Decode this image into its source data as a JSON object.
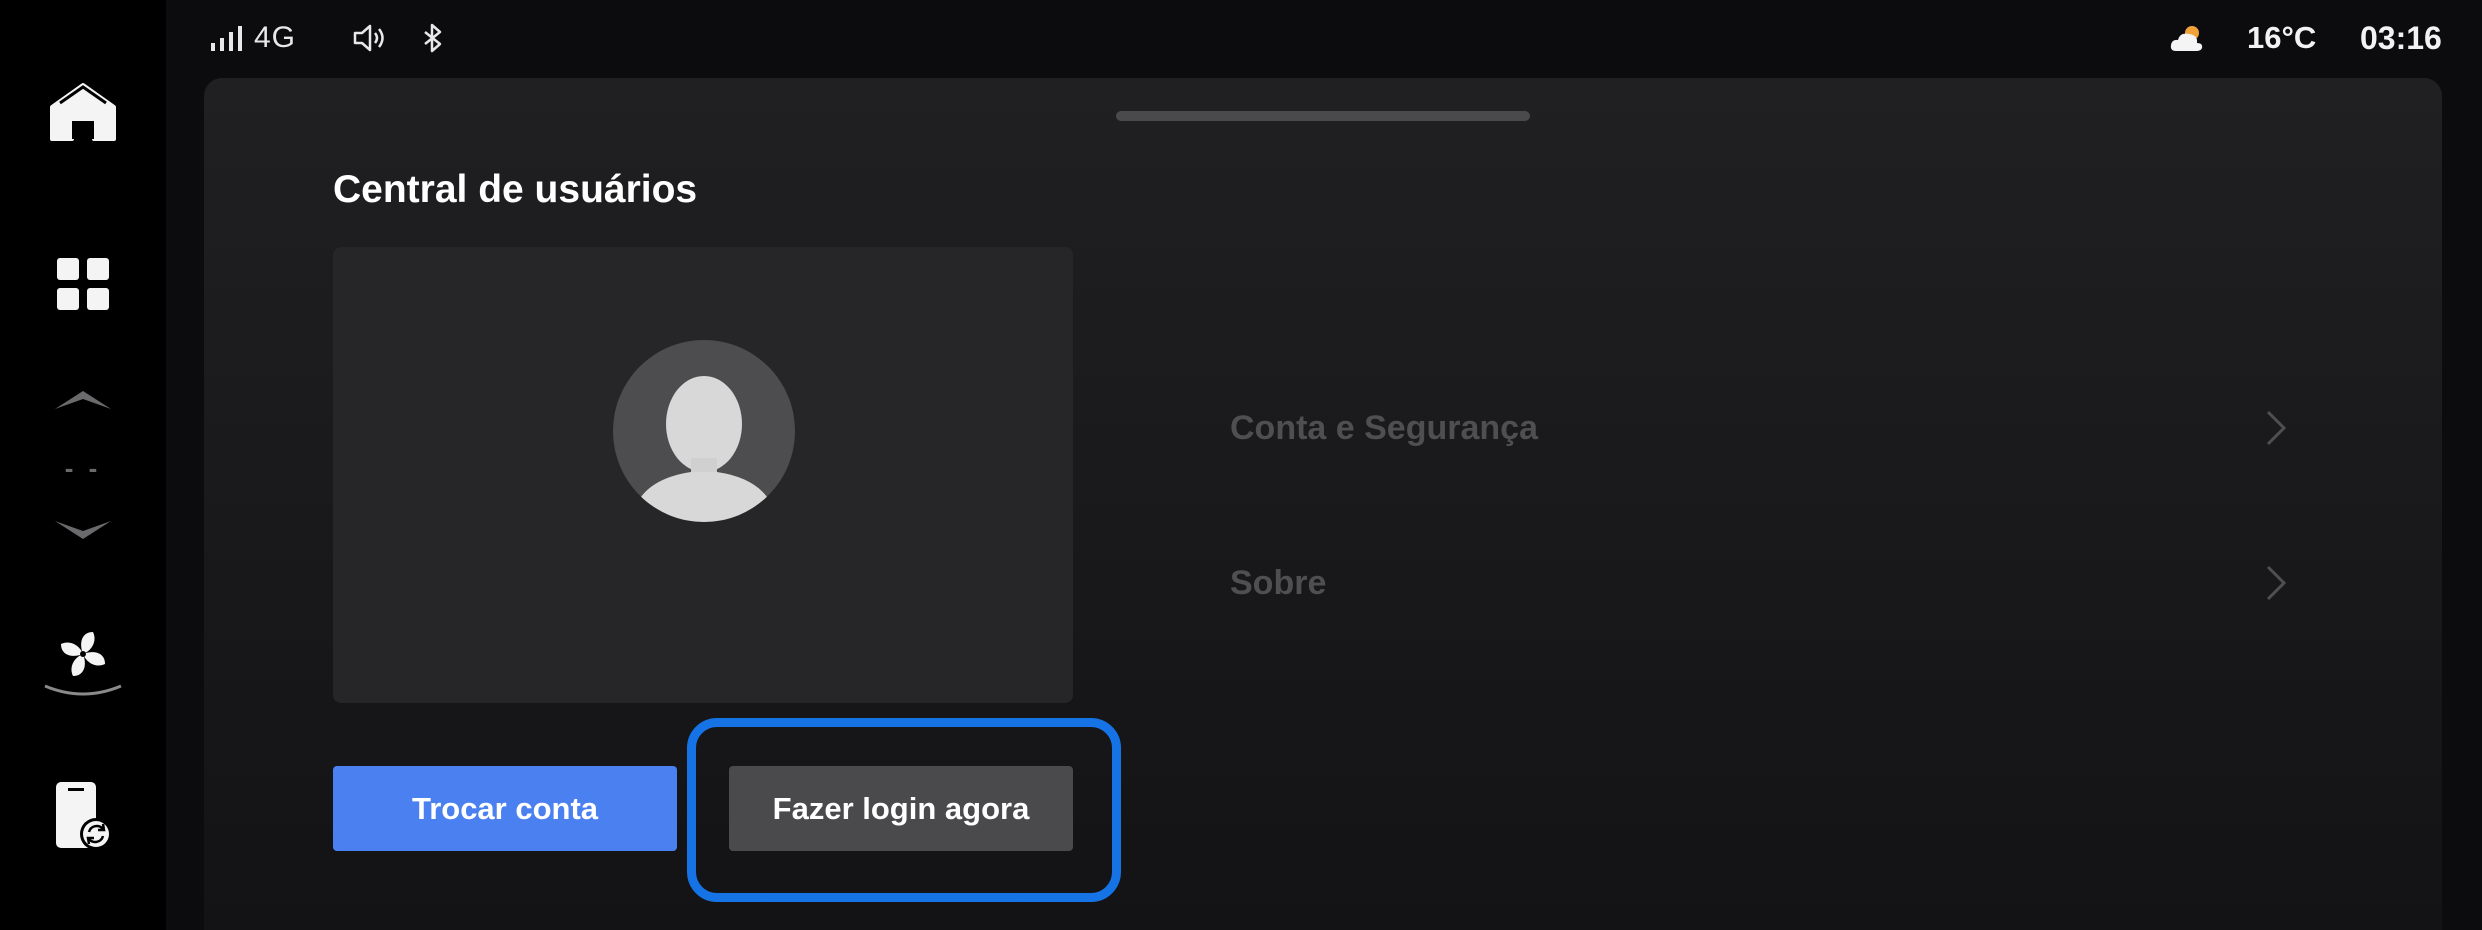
{
  "status_bar": {
    "network": "4G",
    "temperature": "16°C",
    "time": "03:16",
    "icons": [
      "signal-icon",
      "volume-icon",
      "bluetooth-icon",
      "weather-icon"
    ]
  },
  "dock": {
    "items": [
      "home-icon",
      "apps-grid-icon",
      "chevron-up-icon",
      "chevron-down-icon",
      "fan-icon",
      "phone-sync-icon"
    ],
    "fan_level": "- -"
  },
  "page": {
    "title": "Central de usuários"
  },
  "user_card": {
    "avatar_icon": "avatar-placeholder-icon"
  },
  "buttons": {
    "switch_account": "Trocar conta",
    "login_now": "Fazer login agora"
  },
  "menu": {
    "items": [
      {
        "label": "Conta e Segurança",
        "icon": "chevron-right-icon"
      },
      {
        "label": "Sobre",
        "icon": "chevron-right-icon"
      }
    ]
  },
  "colors": {
    "primary_button": "#4a80f0",
    "secondary_button": "#4a4a4c",
    "highlight": "#1673e6",
    "panel": "#1e1e20"
  }
}
